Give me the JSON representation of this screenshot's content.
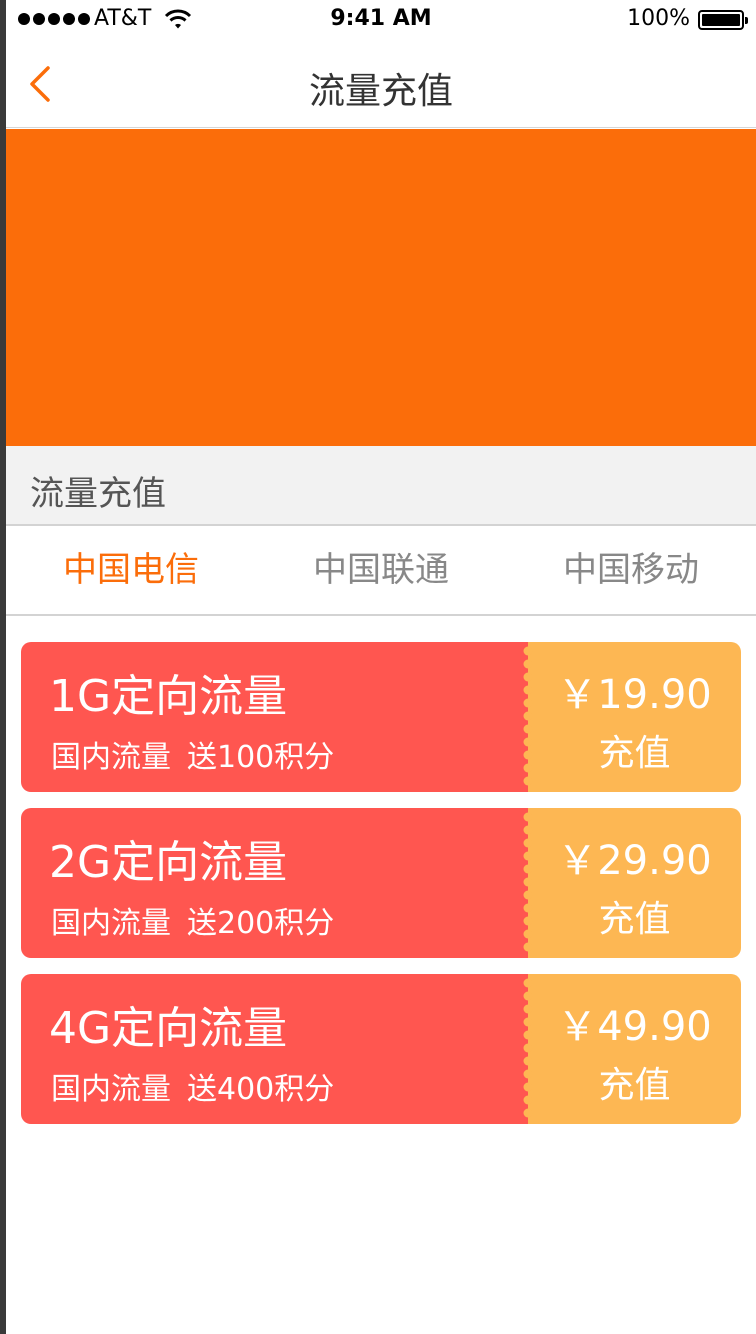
{
  "status_bar": {
    "carrier": "AT&T",
    "time": "9:41 AM",
    "battery": "100%"
  },
  "nav": {
    "title": "流量充值",
    "back_icon": "chevron-left-icon"
  },
  "section": {
    "title": "流量充值"
  },
  "tabs": [
    {
      "label": "中国电信",
      "active": true
    },
    {
      "label": "中国联通",
      "active": false
    },
    {
      "label": "中国移动",
      "active": false
    }
  ],
  "colors": {
    "accent": "#fb6d0a",
    "card_left": "#ff5650",
    "card_right": "#fdb753"
  },
  "packages": [
    {
      "name": "1G定向流量",
      "scope": "国内流量",
      "bonus": "送100积分",
      "price": "￥19.90",
      "action": "充值"
    },
    {
      "name": "2G定向流量",
      "scope": "国内流量",
      "bonus": "送200积分",
      "price": "￥29.90",
      "action": "充值"
    },
    {
      "name": "4G定向流量",
      "scope": "国内流量",
      "bonus": "送400积分",
      "price": "￥49.90",
      "action": "充值"
    }
  ]
}
